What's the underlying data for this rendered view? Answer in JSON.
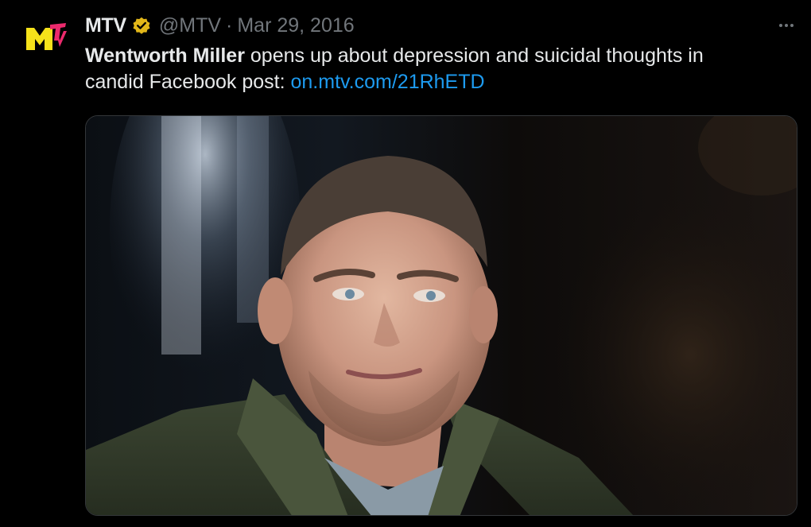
{
  "tweet": {
    "display_name": "MTV",
    "handle": "@MTV",
    "separator": "·",
    "date": "Mar 29, 2016",
    "text_bold": "Wentworth Miller",
    "text_rest_line1": " opens up about depression and suicidal thoughts in",
    "text_line2": "candid Facebook post: ",
    "link_text": "on.mtv.com/21RhETD"
  },
  "avatar": {
    "logo_letters": "MTV"
  },
  "colors": {
    "background": "#000000",
    "text": "#e7e9ea",
    "muted": "#71767b",
    "link": "#1d9bf0",
    "verified_gold": "#e2b719",
    "logo_yellow": "#f5e21a"
  },
  "icons": {
    "verified": "verified-badge-icon",
    "more": "more-horizontal-icon"
  }
}
